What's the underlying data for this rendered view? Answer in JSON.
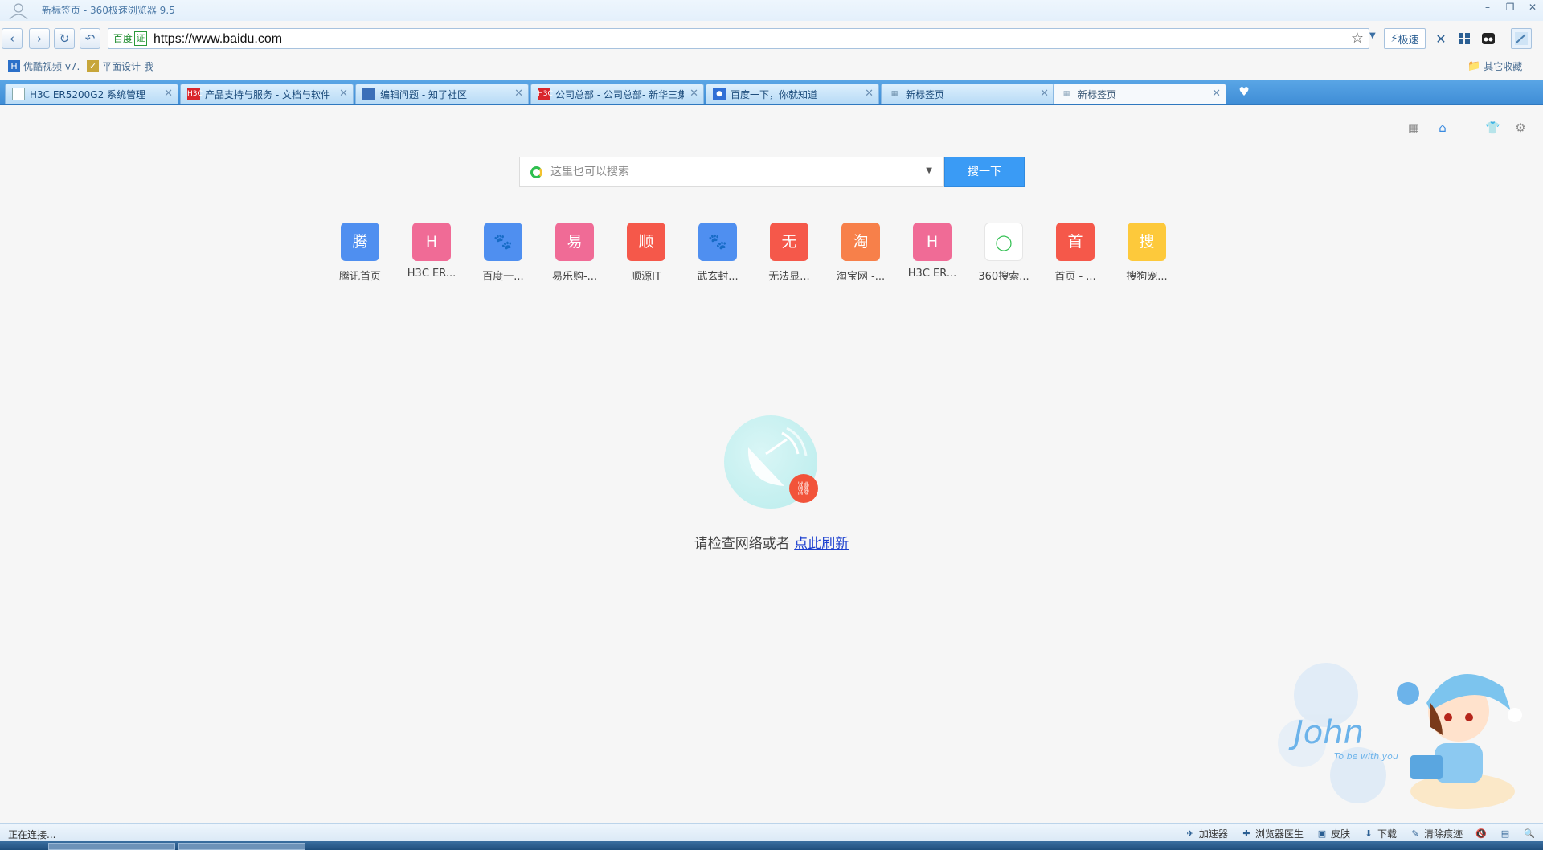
{
  "window": {
    "title": "新标签页 - 360极速浏览器 9.5"
  },
  "nav": {
    "back": "‹",
    "forward": "›",
    "reload": "↻",
    "undo": "↶"
  },
  "address": {
    "site_label": "百度",
    "cert_label": "证",
    "url": "https://www.baidu.com"
  },
  "toolbar": {
    "speed_label": "极速"
  },
  "bookmarks": [
    {
      "icon": "H",
      "label": "优酷视频 v7."
    },
    {
      "icon": "✓",
      "label": "平面设计-我"
    }
  ],
  "other_bookmarks": "其它收藏",
  "tabs": [
    {
      "label": "H3C ER5200G2 系统管理",
      "active": false,
      "icon_text": ""
    },
    {
      "label": "产品支持与服务 - 文档与软件",
      "active": false,
      "icon_text": "H3C"
    },
    {
      "label": "编辑问题 - 知了社区",
      "active": false,
      "icon_text": ""
    },
    {
      "label": "公司总部 - 公司总部- 新华三集",
      "active": false,
      "icon_text": "H3C"
    },
    {
      "label": "百度一下，你就知道",
      "active": false,
      "icon_text": ""
    },
    {
      "label": "新标签页",
      "active": false,
      "icon_text": ""
    },
    {
      "label": "新标签页",
      "active": true,
      "icon_text": ""
    }
  ],
  "search": {
    "placeholder": "这里也可以搜索",
    "button_label": "搜一下"
  },
  "tiles": [
    {
      "glyph": "腾",
      "label": "腾讯首页",
      "color": "#4f8ff0"
    },
    {
      "glyph": "H",
      "label": "H3C ER...",
      "color": "#f06b96"
    },
    {
      "glyph": "🐾",
      "label": "百度一...",
      "color": "#4f8ff0"
    },
    {
      "glyph": "易",
      "label": "易乐购-...",
      "color": "#f06b96"
    },
    {
      "glyph": "顺",
      "label": "顺源IT",
      "color": "#f5584a"
    },
    {
      "glyph": "🐾",
      "label": "武玄封...",
      "color": "#4f8ff0"
    },
    {
      "glyph": "无",
      "label": "无法显...",
      "color": "#f5584a"
    },
    {
      "glyph": "淘",
      "label": "淘宝网 -...",
      "color": "#f7804a"
    },
    {
      "glyph": "H",
      "label": "H3C ER...",
      "color": "#f06b96"
    },
    {
      "glyph": "◯",
      "label": "360搜索...",
      "color": "#ffffff"
    },
    {
      "glyph": "首",
      "label": "首页 - ...",
      "color": "#f5584a"
    },
    {
      "glyph": "搜",
      "label": "搜狗宠...",
      "color": "#fdc93b"
    }
  ],
  "error": {
    "message": "请检查网络或者",
    "link": "点此刷新"
  },
  "status": {
    "text": "正在连接...",
    "items": [
      {
        "icon": "✈",
        "label": "加速器"
      },
      {
        "icon": "✚",
        "label": "浏览器医生"
      },
      {
        "icon": "▣",
        "label": "皮肤"
      },
      {
        "icon": "⬇",
        "label": "下载"
      },
      {
        "icon": "✎",
        "label": "清除痕迹"
      },
      {
        "icon": "🔇",
        "label": ""
      },
      {
        "icon": "▤",
        "label": ""
      },
      {
        "icon": "🔍",
        "label": ""
      }
    ]
  },
  "skin_text": {
    "name": "John",
    "tagline": "To be with you"
  },
  "colors": {
    "tab_strip": "#3f8dd6",
    "search_button": "#3a9bf5",
    "error_link": "#1b3fcf",
    "error_badge": "#f2533a"
  }
}
